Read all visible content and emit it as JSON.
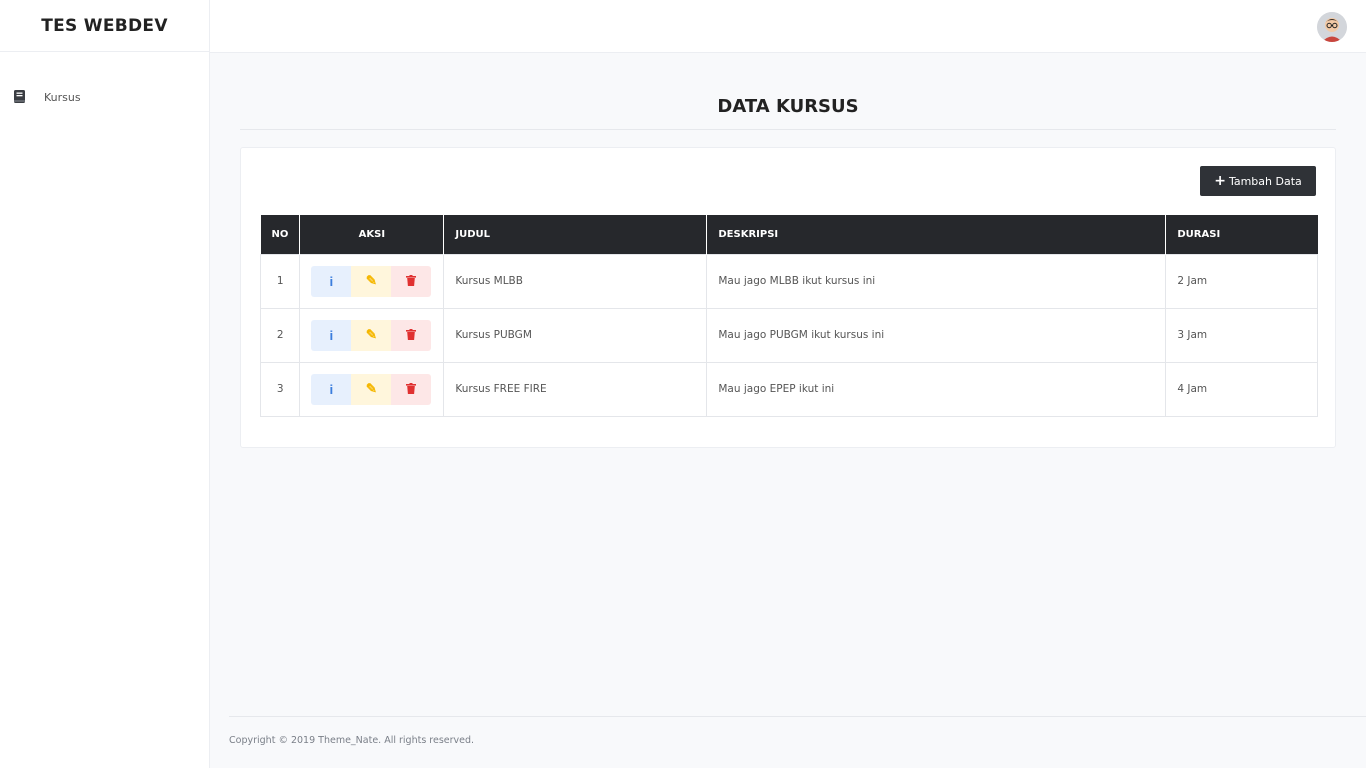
{
  "brand": "TES WEBDEV",
  "sidebar": {
    "items": [
      {
        "label": "Kursus",
        "icon": "book-icon"
      }
    ]
  },
  "topbar": {
    "avatar_icon": "user-avatar"
  },
  "main": {
    "title": "DATA KURSUS",
    "add_button": "Tambah Data",
    "table": {
      "headers": [
        "NO",
        "AKSI",
        "JUDUL",
        "DESKRIPSI",
        "DURASI"
      ],
      "rows": [
        {
          "no": "1",
          "judul": "Kursus MLBB",
          "deskripsi": "Mau jago MLBB ikut kursus ini",
          "durasi": "2 Jam"
        },
        {
          "no": "2",
          "judul": "Kursus PUBGM",
          "deskripsi": "Mau jago PUBGM ikut kursus ini",
          "durasi": "3 Jam"
        },
        {
          "no": "3",
          "judul": "Kursus FREE FIRE",
          "deskripsi": "Mau jago EPEP ikut ini",
          "durasi": "4 Jam"
        }
      ]
    }
  },
  "footer": {
    "text": "Copyright © 2019 Theme_Nate. All rights reserved."
  },
  "colors": {
    "dark": "#26282c",
    "info": "#3b7ddd",
    "edit": "#f5b700",
    "delete": "#e03131",
    "background": "#f8f9fb"
  }
}
